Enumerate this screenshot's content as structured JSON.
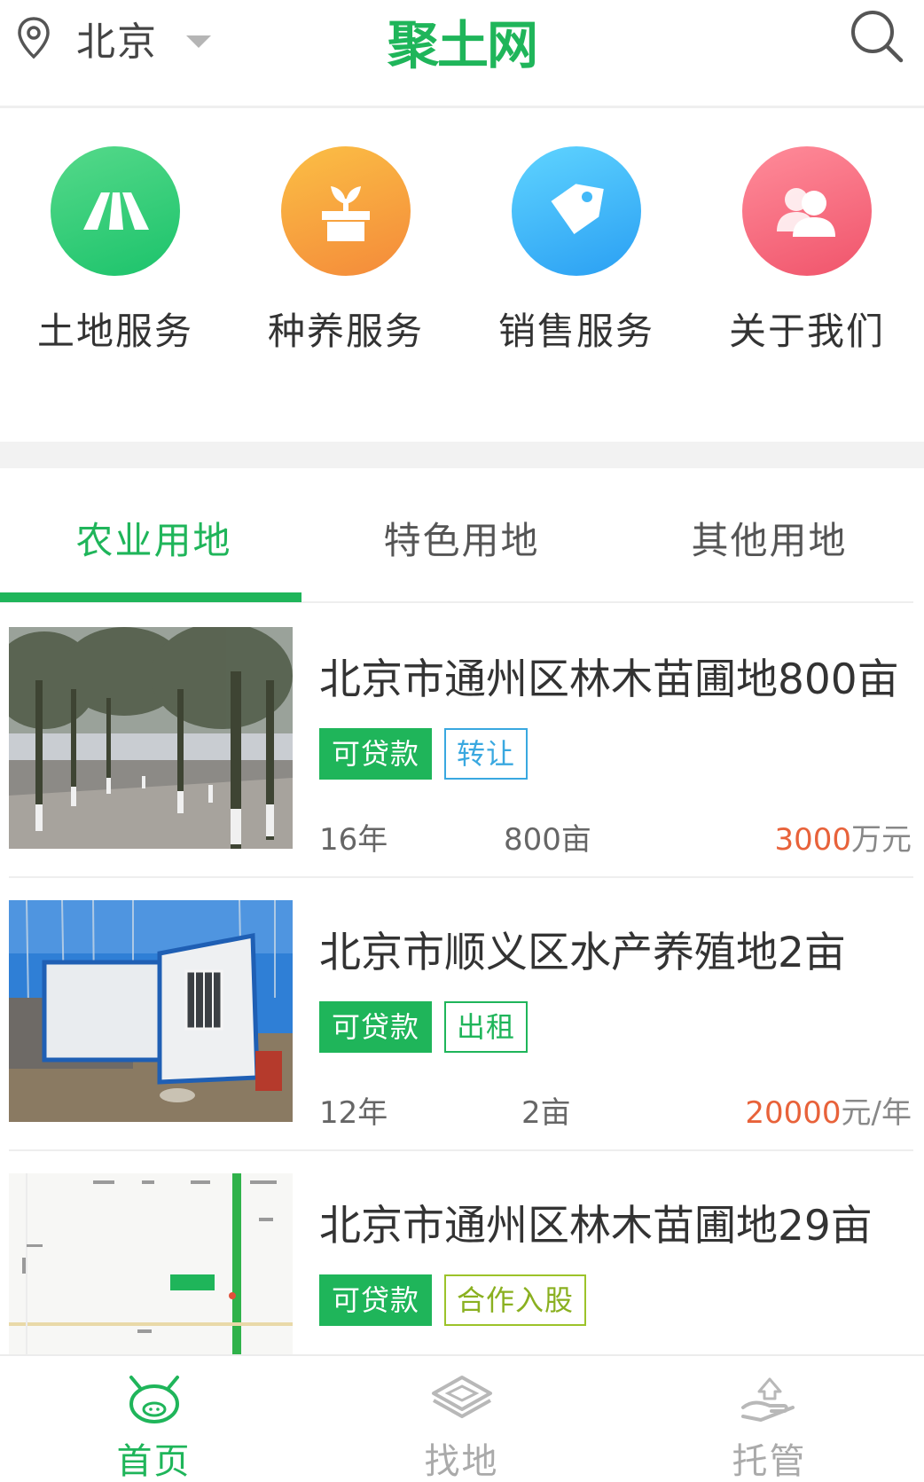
{
  "header": {
    "city": "北京",
    "logo": "聚土网",
    "icons": {
      "location": "location-pin-icon",
      "dropdown": "caret-down-icon",
      "search": "search-icon"
    }
  },
  "services": [
    {
      "label": "土地服务",
      "icon": "road-icon",
      "color": "#1cc36b"
    },
    {
      "label": "种养服务",
      "icon": "plant-pot-icon",
      "color": "#f48a3a"
    },
    {
      "label": "销售服务",
      "icon": "price-tag-icon",
      "color": "#2a9ff3"
    },
    {
      "label": "关于我们",
      "icon": "users-icon",
      "color": "#f0546b"
    }
  ],
  "tabs": [
    {
      "label": "农业用地",
      "active": true
    },
    {
      "label": "特色用地",
      "active": false
    },
    {
      "label": "其他用地",
      "active": false
    }
  ],
  "listings": [
    {
      "title": "北京市通州区林木苗圃地800亩",
      "tags": [
        "可贷款",
        "转让"
      ],
      "years": "16年",
      "area": "800亩",
      "price": "3000",
      "price_unit": "万元",
      "image": "tree-nursery-photo"
    },
    {
      "title": "北京市顺义区水产养殖地2亩",
      "tags": [
        "可贷款",
        "出租"
      ],
      "years": "12年",
      "area": "2亩",
      "price": "20000",
      "price_unit": "元/年",
      "image": "container-house-photo"
    },
    {
      "title": "北京市通州区林木苗圃地29亩",
      "tags": [
        "可贷款",
        "合作入股"
      ],
      "image": "site-map-image"
    }
  ],
  "bottom_nav": [
    {
      "label": "首页",
      "icon": "home-face-icon",
      "active": true
    },
    {
      "label": "找地",
      "icon": "find-land-icon",
      "active": false
    },
    {
      "label": "托管",
      "icon": "hosting-hand-icon",
      "active": false
    }
  ],
  "colors": {
    "brand": "#1fb55a",
    "price": "#e8623a",
    "tag_blue": "#39a8e0",
    "tag_olive": "#9cc32a"
  }
}
